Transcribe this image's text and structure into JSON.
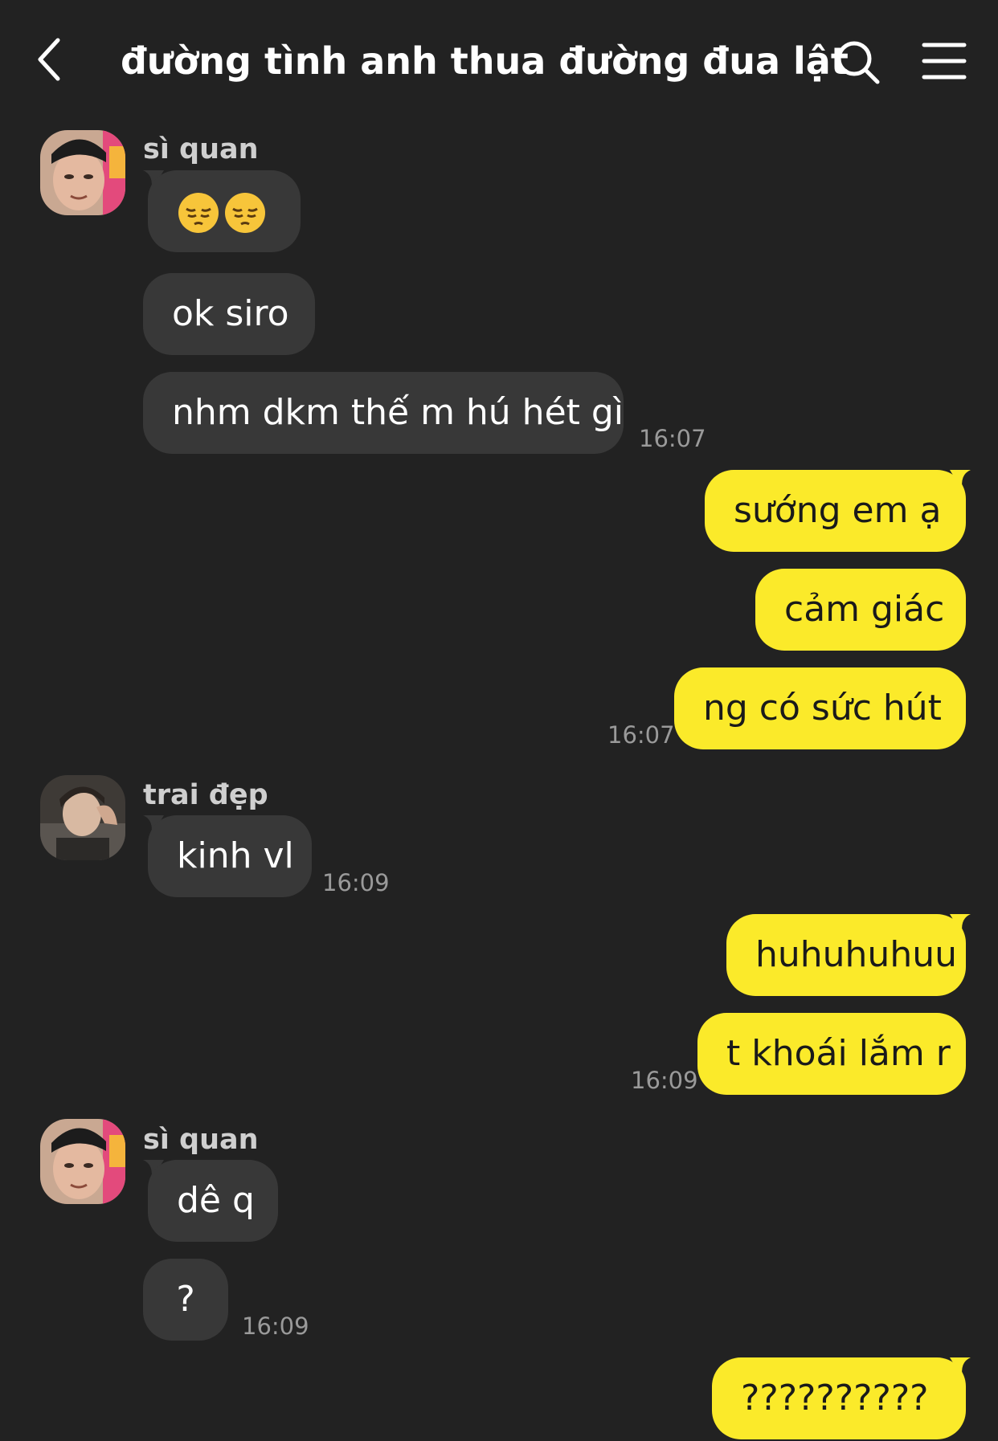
{
  "header": {
    "title": "đường tình anh thua đường đua lật bá...",
    "back_icon": "chevron-left-icon",
    "search_icon": "search-icon",
    "menu_icon": "hamburger-menu-icon"
  },
  "colors": {
    "background": "#222222",
    "incoming_bubble": "#383838",
    "outgoing_bubble": "#fbea2a",
    "timestamp": "#9a9a9a"
  },
  "messages": {
    "g1": {
      "sender": "sì quan",
      "m1_emoji": "pensive-face-emoji x2",
      "m2": "ok siro",
      "m3": "nhm dkm thế m hú hét gì",
      "time": "16:07"
    },
    "g2": {
      "m1": "sướng em ạ",
      "m2": "cảm giác",
      "m3": "ng có sức hút",
      "time": "16:07"
    },
    "g3": {
      "sender": "trai đẹp",
      "m1": "kinh vl",
      "time": "16:09"
    },
    "g4": {
      "m1": "huhuhuhuu",
      "m2": "t khoái lắm r",
      "time": "16:09"
    },
    "g5": {
      "sender": "sì quan",
      "m1": "dê q",
      "m2": "?",
      "time": "16:09"
    },
    "g6": {
      "m1": "??????????"
    }
  }
}
